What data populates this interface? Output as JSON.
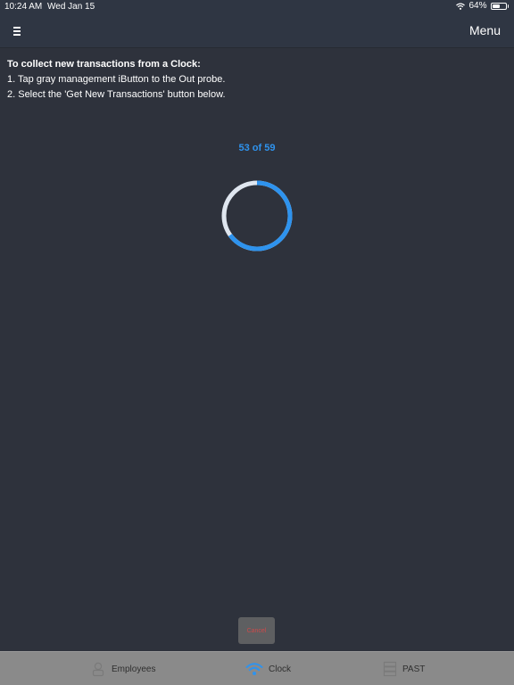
{
  "status_bar": {
    "time": "10:24 AM",
    "date": "Wed Jan 15",
    "battery_percent_label": "64%",
    "battery_level": 0.64
  },
  "nav": {
    "menu_icon": "hamburger-icon",
    "menu_label": "Menu"
  },
  "instructions": {
    "title": "To collect new transactions from a Clock:",
    "steps": [
      "1.  Tap gray management iButton to the Out probe.",
      "2.  Select the 'Get New Transactions' button below."
    ]
  },
  "progress": {
    "label": "53 of 59",
    "current": 53,
    "total": 59,
    "ring_fraction": 0.65,
    "color": "#2e93ee"
  },
  "cancel": {
    "label": "Cancel",
    "color": "#cd4a4a"
  },
  "tabs": [
    {
      "label": "Employees",
      "icon": "employees-icon",
      "active": false
    },
    {
      "label": "Clock",
      "icon": "wifi-icon",
      "active": true
    },
    {
      "label": "PAST",
      "icon": "server-icon",
      "active": false
    }
  ],
  "colors": {
    "background": "#2e323c",
    "nav_background": "#2f3643",
    "accent": "#2e93ee",
    "tab_bar": "#8a8a8a"
  }
}
